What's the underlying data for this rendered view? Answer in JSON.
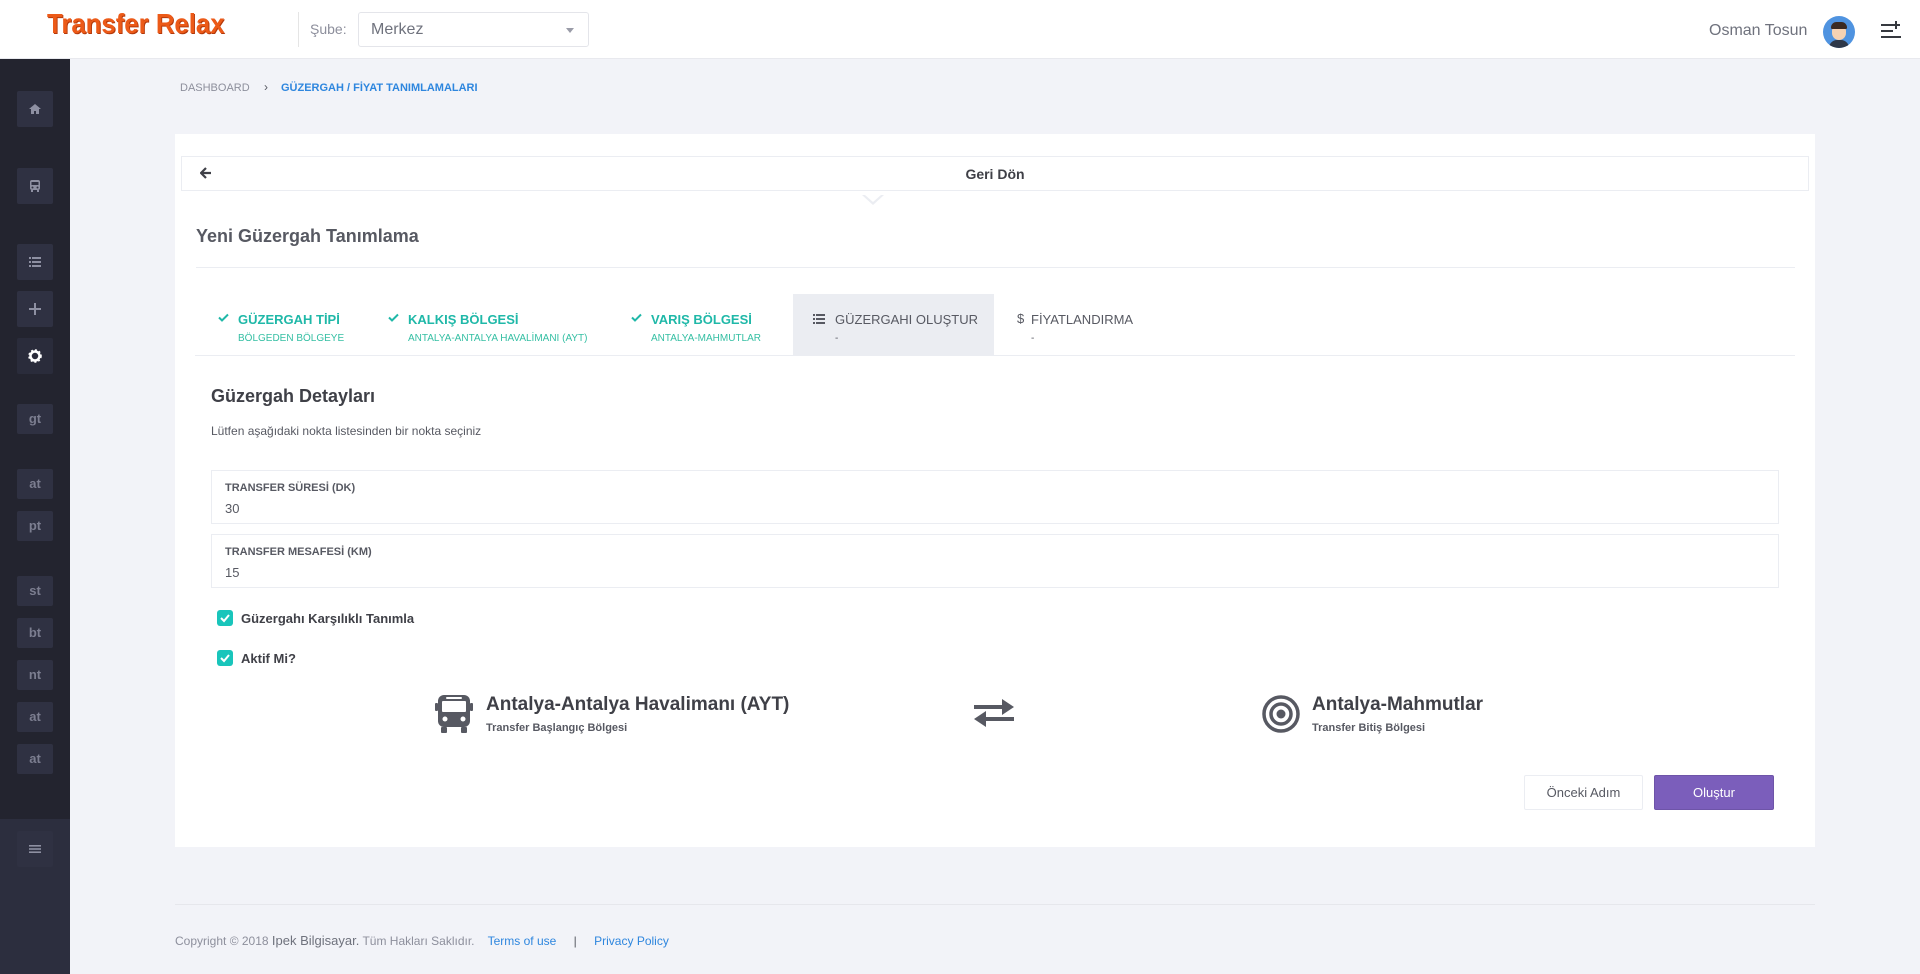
{
  "header": {
    "logo": "Transfer Relax",
    "branch_label": "Şube:",
    "branch_value": "Merkez",
    "user_name": "Osman Tosun"
  },
  "sidebar": {
    "icon_buttons": [
      "home-icon",
      "bus-icon",
      "list-icon",
      "plus-icon",
      "gear-icon"
    ],
    "text_items": [
      "gt",
      "at",
      "pt",
      "st",
      "bt",
      "nt",
      "at",
      "at"
    ],
    "bottom_icon": "menu-icon"
  },
  "breadcrumb": {
    "home": "DASHBOARD",
    "separator": "›",
    "current": "GÜZERGAH / FİYAT TANIMLAMALARI"
  },
  "back": {
    "label": "Geri Dön"
  },
  "card": {
    "title": "Yeni Güzergah Tanımlama"
  },
  "wizard": {
    "steps": [
      {
        "title": "GÜZERGAH TİPİ",
        "subtitle": "BÖLGEDEN BÖLGEYE",
        "state": "done"
      },
      {
        "title": "KALKIŞ BÖLGESİ",
        "subtitle": "ANTALYA-ANTALYA HAVALİMANI (AYT)",
        "state": "done"
      },
      {
        "title": "VARIŞ BÖLGESİ",
        "subtitle": "ANTALYA-MAHMUTLAR",
        "state": "done"
      },
      {
        "title": "GÜZERGAHI OLUŞTUR",
        "subtitle": "-",
        "state": "current"
      },
      {
        "title": "FİYATLANDIRMA",
        "subtitle": "-",
        "state": "pending"
      }
    ]
  },
  "details": {
    "title": "Güzergah Detayları",
    "description": "Lütfen aşağıdaki nokta listesinden bir nokta seçiniz",
    "duration_label": "TRANSFER SÜRESİ (DK)",
    "duration_value": "30",
    "distance_label": "TRANSFER MESAFESİ (KM)",
    "distance_value": "15",
    "mutual_label": "Güzergahı Karşılıklı Tanımla",
    "mutual_checked": true,
    "active_label": "Aktif Mi?",
    "active_checked": true
  },
  "route": {
    "start_name": "Antalya-Antalya Havalimanı (AYT)",
    "start_sub": "Transfer Başlangıç Bölgesi",
    "end_name": "Antalya-Mahmutlar",
    "end_sub": "Transfer Bitiş Bölgesi"
  },
  "actions": {
    "prev": "Önceki Adım",
    "create": "Oluştur"
  },
  "footer": {
    "copyright": "Copyright © 2018",
    "company": "Ipek Bilgisayar.",
    "rights": "Tüm Hakları Saklıdır.",
    "terms": "Terms of use",
    "separator": "|",
    "privacy": "Privacy Policy"
  },
  "colors": {
    "accent_orange": "#ec5a18",
    "accent_teal": "#1fb8a8",
    "primary_purple": "#7b5ebb",
    "link_blue": "#2e86de",
    "sidebar_bg": "#23242f"
  }
}
